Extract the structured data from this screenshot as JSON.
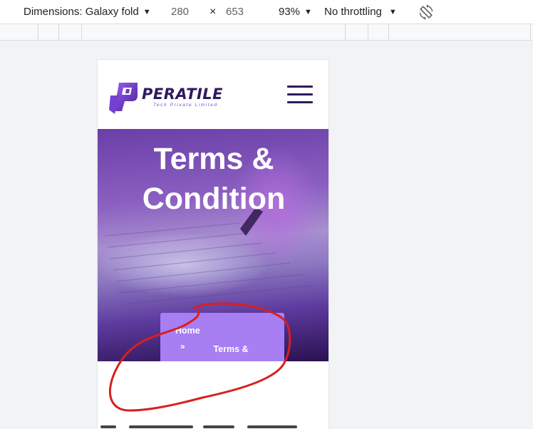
{
  "toolbar": {
    "dimensions_label": "Dimensions: Galaxy fold",
    "width": "280",
    "times": "×",
    "height": "653",
    "zoom": "93%",
    "throttling": "No throttling"
  },
  "site": {
    "brand_name": "PERATILE",
    "brand_tagline": "Tech Private Limited",
    "hero_title_line1": "Terms &",
    "hero_title_line2": "Condition",
    "breadcrumb": {
      "home": "Home",
      "separator": "»",
      "current": "Terms & Condition"
    }
  },
  "colors": {
    "brand_dark": "#2e1a5c",
    "breadcrumb_bg": "#a87ef3",
    "annotation": "#d81f1f"
  }
}
